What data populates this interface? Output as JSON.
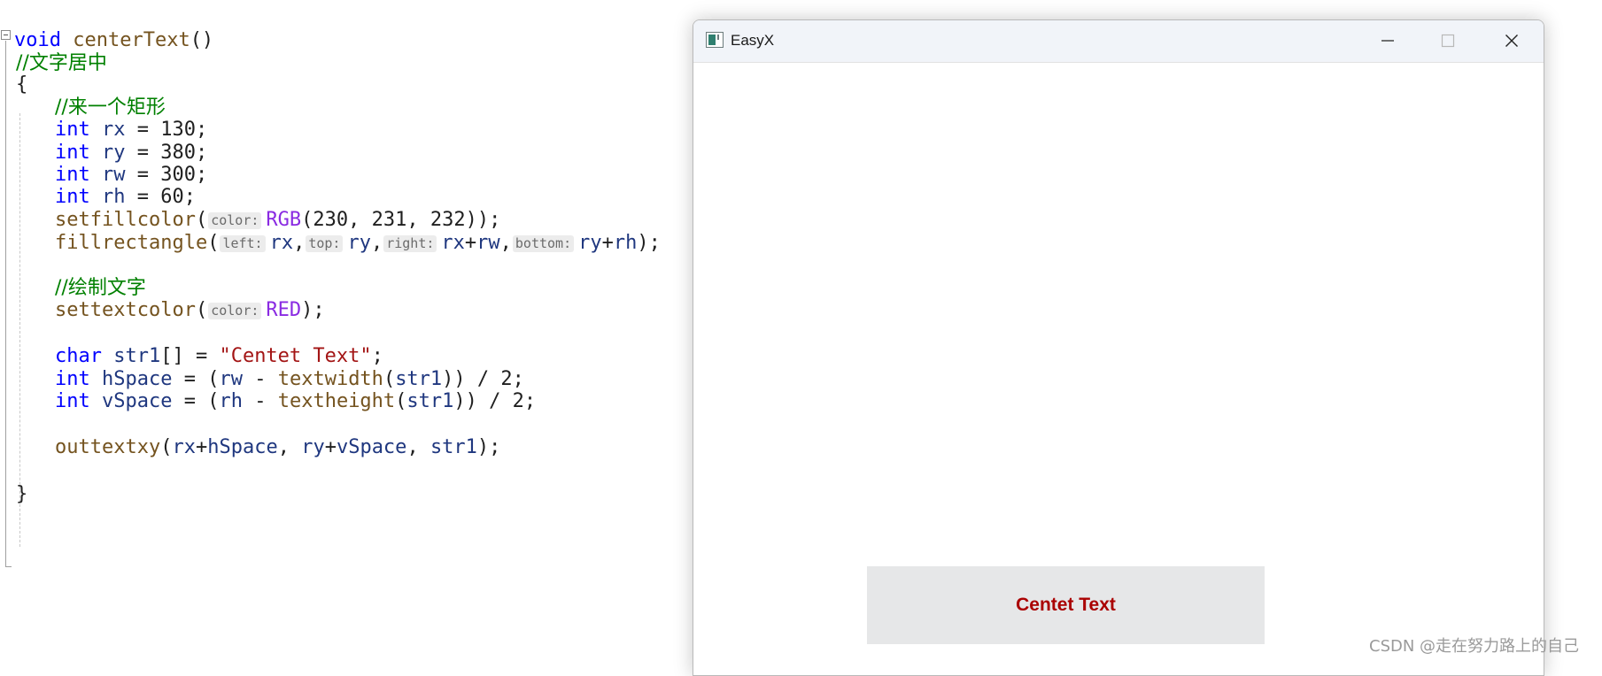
{
  "editor": {
    "lines": [
      {
        "tokens": [
          {
            "cls": "kw",
            "text": "void"
          },
          {
            "cls": "pl",
            "text": " "
          },
          {
            "cls": "fn",
            "text": "centerText"
          },
          {
            "cls": "pl",
            "text": "()"
          }
        ]
      },
      {
        "tokens": [
          {
            "cls": "cm",
            "text": "//文字居中"
          }
        ]
      },
      {
        "tokens": [
          {
            "cls": "pl",
            "text": "{"
          }
        ]
      },
      {
        "tokens": [
          {
            "cls": "cm",
            "text": "//来一个矩形"
          }
        ]
      },
      {
        "tokens": [
          {
            "cls": "kw",
            "text": "int"
          },
          {
            "cls": "pl",
            "text": " "
          },
          {
            "cls": "var",
            "text": "rx"
          },
          {
            "cls": "pl",
            "text": " = 130;"
          }
        ]
      },
      {
        "tokens": [
          {
            "cls": "kw",
            "text": "int"
          },
          {
            "cls": "pl",
            "text": " "
          },
          {
            "cls": "var",
            "text": "ry"
          },
          {
            "cls": "pl",
            "text": " = 380;"
          }
        ]
      },
      {
        "tokens": [
          {
            "cls": "kw",
            "text": "int"
          },
          {
            "cls": "pl",
            "text": " "
          },
          {
            "cls": "var",
            "text": "rw"
          },
          {
            "cls": "pl",
            "text": " = 300;"
          }
        ]
      },
      {
        "tokens": [
          {
            "cls": "kw",
            "text": "int"
          },
          {
            "cls": "pl",
            "text": " "
          },
          {
            "cls": "var",
            "text": "rh"
          },
          {
            "cls": "pl",
            "text": " = 60;"
          }
        ]
      },
      {
        "tokens": [
          {
            "cls": "fn",
            "text": "setfillcolor"
          },
          {
            "cls": "pl",
            "text": "("
          },
          {
            "cls": "hint",
            "text": "color:"
          },
          {
            "cls": "mac",
            "text": "RGB"
          },
          {
            "cls": "pl",
            "text": "(230, 231, 232));"
          }
        ]
      },
      {
        "tokens": [
          {
            "cls": "fn",
            "text": "fillrectangle"
          },
          {
            "cls": "pl",
            "text": "("
          },
          {
            "cls": "hint",
            "text": "left:"
          },
          {
            "cls": "var",
            "text": "rx"
          },
          {
            "cls": "pl",
            "text": ","
          },
          {
            "cls": "hint",
            "text": "top:"
          },
          {
            "cls": "var",
            "text": "ry"
          },
          {
            "cls": "pl",
            "text": ","
          },
          {
            "cls": "hint",
            "text": "right:"
          },
          {
            "cls": "var",
            "text": "rx"
          },
          {
            "cls": "pl",
            "text": "+"
          },
          {
            "cls": "var",
            "text": "rw"
          },
          {
            "cls": "pl",
            "text": ","
          },
          {
            "cls": "hint",
            "text": "bottom:"
          },
          {
            "cls": "var",
            "text": "ry"
          },
          {
            "cls": "pl",
            "text": "+"
          },
          {
            "cls": "var",
            "text": "rh"
          },
          {
            "cls": "pl",
            "text": ");"
          }
        ]
      },
      {
        "tokens": []
      },
      {
        "tokens": [
          {
            "cls": "cm",
            "text": "//绘制文字"
          }
        ]
      },
      {
        "tokens": [
          {
            "cls": "fn",
            "text": "settextcolor"
          },
          {
            "cls": "pl",
            "text": "("
          },
          {
            "cls": "hint",
            "text": "color:"
          },
          {
            "cls": "mac",
            "text": "RED"
          },
          {
            "cls": "pl",
            "text": ");"
          }
        ]
      },
      {
        "tokens": []
      },
      {
        "tokens": [
          {
            "cls": "kw",
            "text": "char"
          },
          {
            "cls": "pl",
            "text": " "
          },
          {
            "cls": "var",
            "text": "str1"
          },
          {
            "cls": "pl",
            "text": "[] = "
          },
          {
            "cls": "str",
            "text": "\"Centet Text\""
          },
          {
            "cls": "pl",
            "text": ";"
          }
        ]
      },
      {
        "tokens": [
          {
            "cls": "kw",
            "text": "int"
          },
          {
            "cls": "pl",
            "text": " "
          },
          {
            "cls": "var",
            "text": "hSpace"
          },
          {
            "cls": "pl",
            "text": " = ("
          },
          {
            "cls": "var",
            "text": "rw"
          },
          {
            "cls": "pl",
            "text": " - "
          },
          {
            "cls": "fn",
            "text": "textwidth"
          },
          {
            "cls": "pl",
            "text": "("
          },
          {
            "cls": "var",
            "text": "str1"
          },
          {
            "cls": "pl",
            "text": ")) / 2;"
          }
        ]
      },
      {
        "tokens": [
          {
            "cls": "kw",
            "text": "int"
          },
          {
            "cls": "pl",
            "text": " "
          },
          {
            "cls": "var",
            "text": "vSpace"
          },
          {
            "cls": "pl",
            "text": " = ("
          },
          {
            "cls": "var",
            "text": "rh"
          },
          {
            "cls": "pl",
            "text": " - "
          },
          {
            "cls": "fn",
            "text": "textheight"
          },
          {
            "cls": "pl",
            "text": "("
          },
          {
            "cls": "var",
            "text": "str1"
          },
          {
            "cls": "pl",
            "text": ")) / 2;"
          }
        ]
      },
      {
        "tokens": []
      },
      {
        "tokens": [
          {
            "cls": "fn",
            "text": "outtextxy"
          },
          {
            "cls": "pl",
            "text": "("
          },
          {
            "cls": "var",
            "text": "rx"
          },
          {
            "cls": "pl",
            "text": "+"
          },
          {
            "cls": "var",
            "text": "hSpace"
          },
          {
            "cls": "pl",
            "text": ", "
          },
          {
            "cls": "var",
            "text": "ry"
          },
          {
            "cls": "pl",
            "text": "+"
          },
          {
            "cls": "var",
            "text": "vSpace"
          },
          {
            "cls": "pl",
            "text": ", "
          },
          {
            "cls": "var",
            "text": "str1"
          },
          {
            "cls": "pl",
            "text": ");"
          }
        ]
      },
      {
        "tokens": []
      },
      {
        "tokens": []
      },
      {
        "tokens": [
          {
            "cls": "pl",
            "text": "}"
          }
        ]
      }
    ]
  },
  "window": {
    "title": "EasyX",
    "app_icon": "easyx-app-icon",
    "controls": {
      "minimize_icon": "minimize-icon",
      "maximize_icon": "maximize-icon",
      "close_icon": "close-icon"
    },
    "canvas": {
      "fill_color": "#e6e7e8",
      "text": "Centet Text",
      "text_color": "#aa0000"
    }
  },
  "watermark": "CSDN @走在努力路上的自己"
}
